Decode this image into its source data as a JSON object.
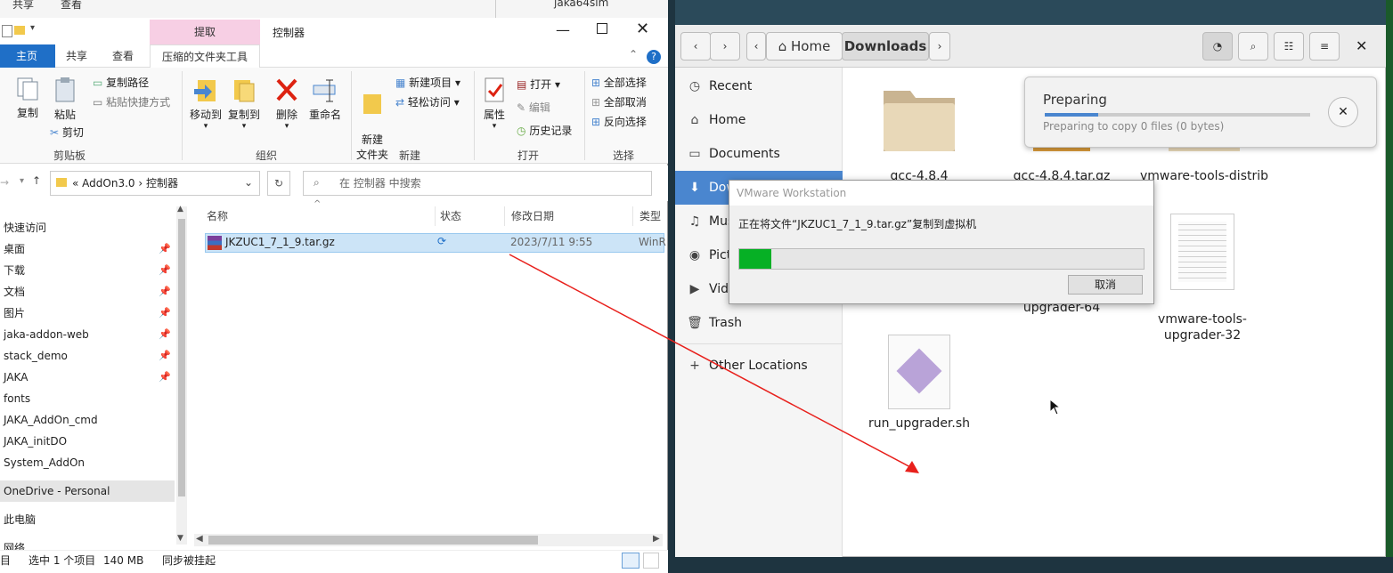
{
  "explorer": {
    "bg_window": {
      "items": [
        "共享",
        "查看"
      ],
      "tree_item": "jaka64sim"
    },
    "compress_tab": "提取",
    "title": "控制器",
    "ribbon_tabs": [
      "主页",
      "共享",
      "查看",
      "压缩的文件夹工具"
    ],
    "clipboard": {
      "copy": "复制",
      "paste": "粘贴",
      "copy_path": "复制路径",
      "paste_shortcut": "粘贴快捷方式",
      "cut": "剪切",
      "label": "剪贴板"
    },
    "organize": {
      "move_to": "移动到",
      "copy_to": "复制到",
      "delete": "删除",
      "rename": "重命名",
      "label": "组织"
    },
    "new": {
      "new_folder": "新建\n文件夹",
      "new_item": "新建项目",
      "easy_access": "轻松访问",
      "label": "新建"
    },
    "open": {
      "properties": "属性",
      "open": "打开",
      "edit": "编辑",
      "history": "历史记录",
      "label": "打开"
    },
    "select": {
      "select_all": "全部选择",
      "select_none": "全部取消",
      "invert": "反向选择",
      "label": "选择"
    },
    "address": {
      "prefix": "«",
      "part1": "AddOn3.0",
      "part2": "控制器"
    },
    "search_placeholder": "在 控制器 中搜索",
    "columns": [
      "名称",
      "状态",
      "修改日期",
      "类型"
    ],
    "file": {
      "name": "JKZUC1_7_1_9.tar.gz",
      "date": "2023/7/11 9:55",
      "type": "WinR"
    },
    "nav": [
      {
        "label": "快速访问",
        "pinned": false
      },
      {
        "label": "桌面",
        "pinned": true
      },
      {
        "label": "下载",
        "pinned": true
      },
      {
        "label": "文档",
        "pinned": true
      },
      {
        "label": "图片",
        "pinned": true
      },
      {
        "label": "jaka-addon-web",
        "pinned": true
      },
      {
        "label": "stack_demo",
        "pinned": true
      },
      {
        "label": "JAKA",
        "pinned": true
      },
      {
        "label": "fonts",
        "pinned": false
      },
      {
        "label": "JAKA_AddOn_cmd",
        "pinned": false
      },
      {
        "label": "JAKA_initDO",
        "pinned": false
      },
      {
        "label": "System_AddOn",
        "pinned": false
      },
      {
        "label": "OneDrive - Personal",
        "pinned": false
      },
      {
        "label": "此电脑",
        "pinned": false
      },
      {
        "label": "网络",
        "pinned": false
      }
    ],
    "status": {
      "items": "目",
      "selected": "选中 1 个项目",
      "size": "140 MB",
      "sync": "同步被挂起"
    }
  },
  "files_app": {
    "path": [
      "Home",
      "Downloads"
    ],
    "sidebar": [
      "Recent",
      "Home",
      "Documents",
      "Downloads",
      "Music",
      "Pictures",
      "Videos",
      "Trash",
      "Other Locations"
    ],
    "sidebar_visible": [
      "Recent",
      "Home",
      "Documents",
      "Dow",
      "Mus",
      "Pict",
      "Vide",
      "Trash",
      "Other Locations"
    ],
    "files": [
      {
        "name": "gcc-4.8.4",
        "kind": "folder"
      },
      {
        "name": "gcc-4.8.4.tar.gz",
        "kind": "archive"
      },
      {
        "name": "vmware-tools-distrib",
        "kind": "folder"
      },
      {
        "name": "upgrader-64",
        "kind": "script"
      },
      {
        "name": "vmware-tools-\nupgrader-32",
        "kind": "text"
      },
      {
        "name": "run_upgrader.sh",
        "kind": "script"
      }
    ],
    "preparing": {
      "title": "Preparing",
      "detail": "Preparing to copy 0 files (0 bytes)",
      "progress": 0.2
    }
  },
  "vmware_dialog": {
    "title": "VMware Workstation",
    "message": "正在将文件“JKZUC1_7_1_9.tar.gz”复制到虚拟机",
    "progress": 0.08,
    "cancel": "取消"
  },
  "colors": {
    "accent": "#1f6fc7",
    "selection": "#4a86cf",
    "progress_green": "#06b025",
    "arrow": "#e8201c",
    "compress_tab": "#f7cfe4"
  }
}
